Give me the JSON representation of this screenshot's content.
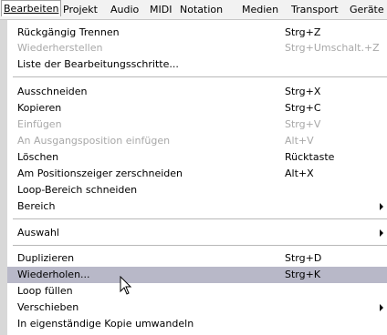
{
  "menubar": {
    "items": [
      "Bearbeiten",
      "Projekt",
      "Audio",
      "MIDI",
      "Notation",
      "Medien",
      "Transport",
      "Geräte"
    ]
  },
  "menu": {
    "items": [
      {
        "label": "Rückgängig Trennen",
        "shortcut": "Strg+Z"
      },
      {
        "label": "Wiederherstellen",
        "shortcut": "Strg+Umschalt.+Z",
        "disabled": true
      },
      {
        "label": "Liste der Bearbeitungsschritte..."
      },
      {
        "label": "Ausschneiden",
        "shortcut": "Strg+X"
      },
      {
        "label": "Kopieren",
        "shortcut": "Strg+C"
      },
      {
        "label": "Einfügen",
        "shortcut": "Strg+V",
        "disabled": true
      },
      {
        "label": "An Ausgangsposition einfügen",
        "shortcut": "Alt+V",
        "disabled": true
      },
      {
        "label": "Löschen",
        "shortcut": "Rücktaste"
      },
      {
        "label": "Am Positionszeiger zerschneiden",
        "shortcut": "Alt+X"
      },
      {
        "label": "Loop-Bereich schneiden"
      },
      {
        "label": "Bereich",
        "submenu": true
      },
      {
        "label": "Auswahl",
        "submenu": true
      },
      {
        "label": "Duplizieren",
        "shortcut": "Strg+D"
      },
      {
        "label": "Wiederholen...",
        "shortcut": "Strg+K",
        "highlighted": true
      },
      {
        "label": "Loop füllen"
      },
      {
        "label": "Verschieben",
        "submenu": true
      },
      {
        "label": "In eigenständige Kopie umwandeln"
      }
    ]
  },
  "colors": {
    "menubar_bg": "#f2f2f2",
    "icon_column": "#d8d8d8",
    "highlight": "#b8b8c8",
    "disabled_text": "#a8a8a8"
  },
  "icons": {
    "submenu": "submenu-arrow-icon",
    "cursor": "mouse-pointer-icon"
  }
}
